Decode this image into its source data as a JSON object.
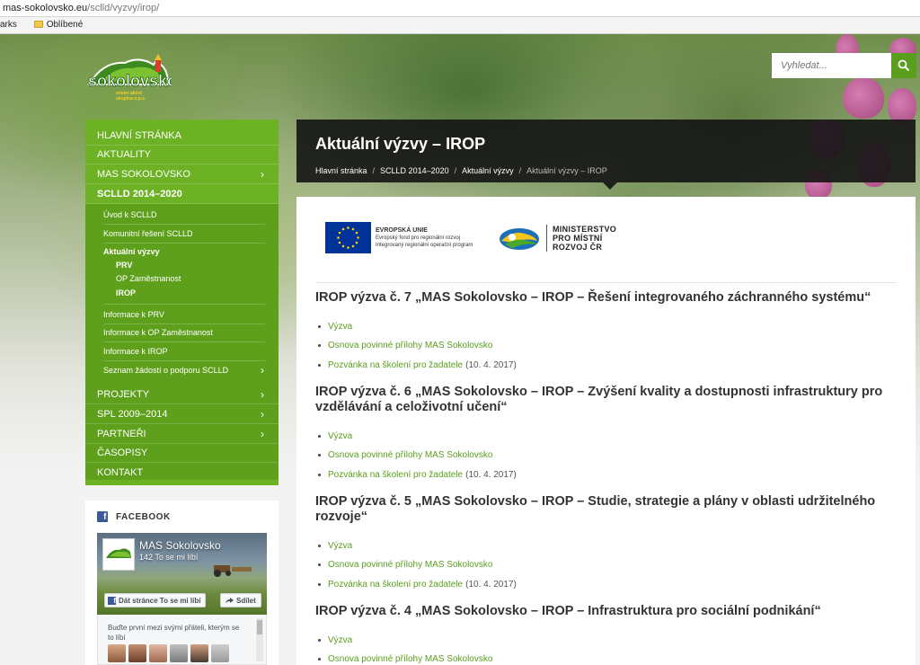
{
  "browser": {
    "url_domain": "mas-sokolovsko.eu",
    "url_path": "/sclld/vyzvy/irop/",
    "bookmarks_bar_prefix": "arks",
    "bookmark_folder": "Oblíbené"
  },
  "site": {
    "logo_text": "sokolovsko",
    "logo_subtext": "místní akční skupina o.p.s."
  },
  "search": {
    "placeholder": "Vyhledat..."
  },
  "menu": {
    "items": [
      {
        "label": "HLAVNÍ STRÁNKA",
        "chevron": false
      },
      {
        "label": "AKTUALITY",
        "chevron": false
      },
      {
        "label": "MAS SOKOLOVSKO",
        "chevron": true
      },
      {
        "label": "SCLLD 2014–2020",
        "chevron": false,
        "active": true
      },
      {
        "label": "PROJEKTY",
        "chevron": true
      },
      {
        "label": "SPL 2009–2014",
        "chevron": true
      },
      {
        "label": "PARTNEŘI",
        "chevron": true
      },
      {
        "label": "ČASOPISY",
        "chevron": false
      },
      {
        "label": "KONTAKT",
        "chevron": false
      }
    ],
    "chevron_glyph": "›",
    "submenu": [
      {
        "label": "Úvod k SCLLD"
      },
      {
        "label": "Komunitní řešení SCLLD"
      },
      {
        "label": "Aktuální výzvy"
      },
      {
        "label": "PRV"
      },
      {
        "label": "OP Zaměstnanost"
      },
      {
        "label": "IROP"
      },
      {
        "label": "Informace k PRV"
      },
      {
        "label": "Informace k OP Zaměstnanost"
      },
      {
        "label": "Informace k IROP"
      },
      {
        "label": "Seznam žádostí o podporu SCLLD"
      }
    ]
  },
  "facebook": {
    "heading": "FACEBOOK",
    "page_name": "MAS Sokolovsko",
    "likes": "142 To se mi líbí",
    "like_button": "Dát stránce To se mi líbí",
    "share_button": "Sdílet",
    "friends_text": "Buďte první mezi svými přáteli, kterým se to líbí"
  },
  "page": {
    "title": "Aktuální výzvy – IROP",
    "breadcrumb": [
      "Hlavní stránka",
      "SCLLD 2014–2020",
      "Aktuální výzvy",
      "Aktuální výzvy – IROP"
    ],
    "breadcrumb_sep": "/"
  },
  "logos": {
    "eu_title": "EVROPSKÁ UNIE",
    "eu_line1": "Evropský fond pro regionální rozvoj",
    "eu_line2": "Integrovaný regionální operační program",
    "mmr_line1": "MINISTERSTVO",
    "mmr_line2": "PRO MÍSTNÍ",
    "mmr_line3": "ROZVOJ ČR"
  },
  "calls": [
    {
      "heading": "IROP výzva č. 7 „MAS Sokolovsko – IROP – Řešení integrovaného záchranného systému“",
      "links": [
        {
          "text": "Výzva",
          "suffix": ""
        },
        {
          "text": "Osnova povinné přílohy MAS Sokolovsko",
          "suffix": ""
        },
        {
          "text": "Pozvánka na školení pro žadatele",
          "suffix": "(10. 4. 2017)"
        }
      ]
    },
    {
      "heading": "IROP výzva č. 6 „MAS Sokolovsko – IROP – Zvýšení kvality a dostupnosti infrastruktury pro vzdělávání a celoživotní učení“",
      "links": [
        {
          "text": "Výzva",
          "suffix": ""
        },
        {
          "text": "Osnova povinné přílohy MAS Sokolovsko",
          "suffix": ""
        },
        {
          "text": "Pozvánka na školení pro žadatele",
          "suffix": "(10. 4. 2017)"
        }
      ]
    },
    {
      "heading": "IROP výzva č. 5 „MAS Sokolovsko – IROP – Studie, strategie a plány v oblasti udržitelného rozvoje“",
      "links": [
        {
          "text": "Výzva",
          "suffix": ""
        },
        {
          "text": "Osnova povinné přílohy MAS Sokolovsko",
          "suffix": ""
        },
        {
          "text": "Pozvánka na školení pro žadatele",
          "suffix": "(10. 4. 2017)"
        }
      ]
    },
    {
      "heading": "IROP výzva č. 4 „MAS Sokolovsko – IROP – Infrastruktura pro sociální podnikání“",
      "links": [
        {
          "text": "Výzva",
          "suffix": ""
        },
        {
          "text": "Osnova povinné přílohy MAS Sokolovsko",
          "suffix": ""
        }
      ]
    }
  ],
  "colors": {
    "menu_green": "#6cb224",
    "submenu_green": "#5ea01c",
    "link_green": "#5a9e1e",
    "title_panel": "#141414"
  }
}
